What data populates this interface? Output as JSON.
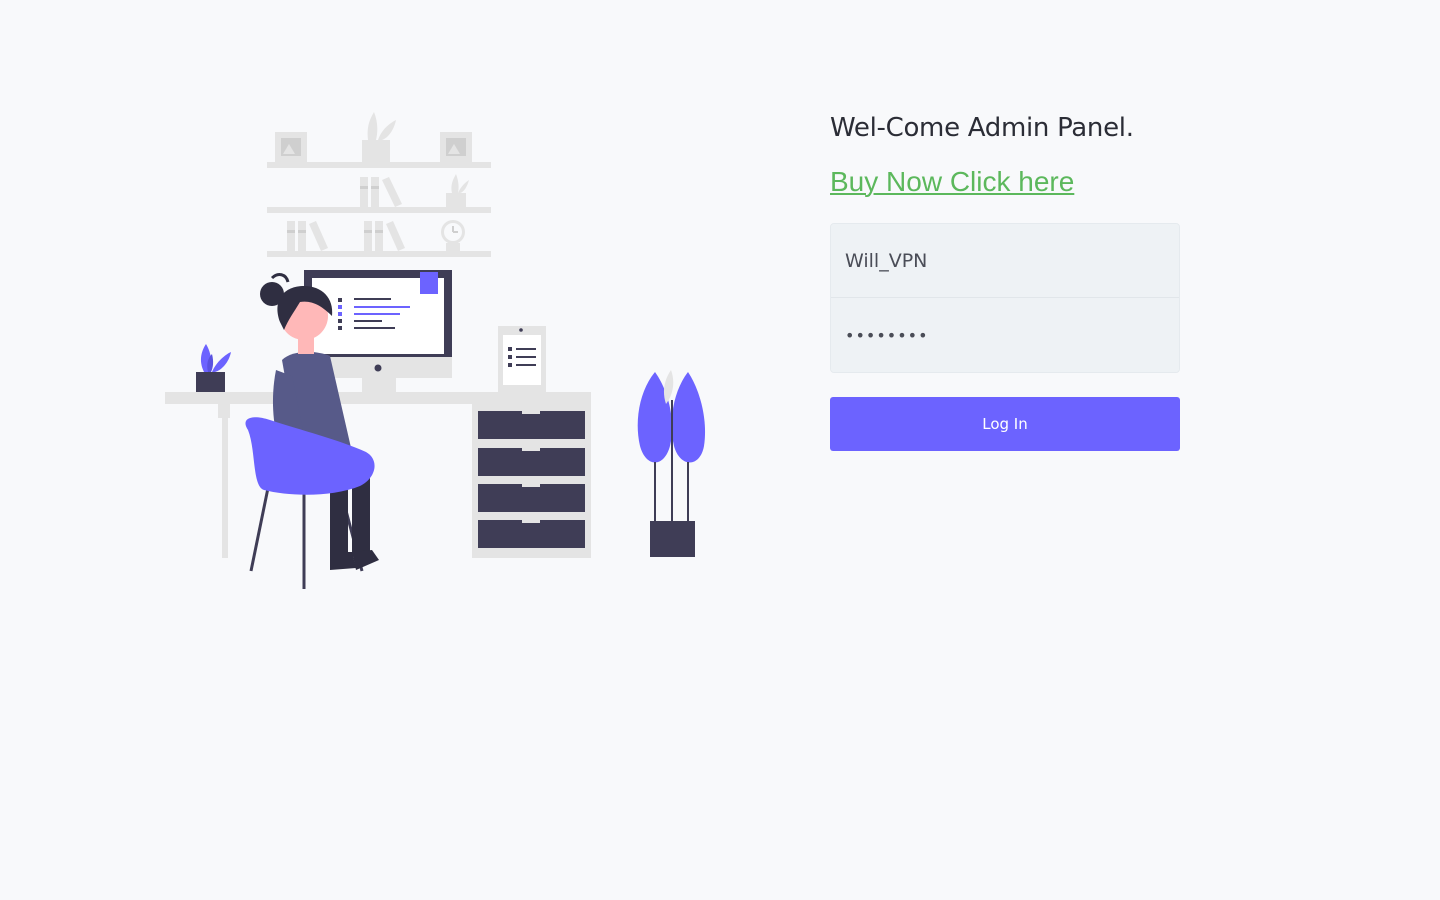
{
  "header": {
    "title": "Wel-Come Admin Panel.",
    "buy_link": "Buy Now Click here"
  },
  "login_form": {
    "username_value": "Will_VPN",
    "password_value": "••••••••",
    "submit_label": "Log In"
  },
  "colors": {
    "accent": "#6c63ff",
    "link": "#5cb85c",
    "background": "#f8f9fb",
    "dark": "#3f3d56"
  },
  "illustration": {
    "name": "working-at-desk-illustration"
  }
}
